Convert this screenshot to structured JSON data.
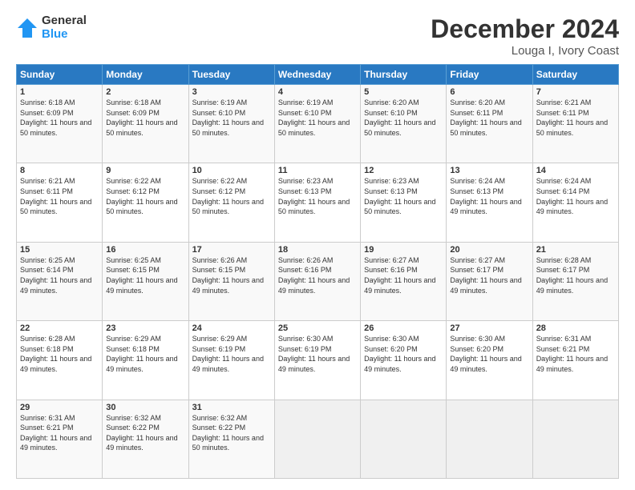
{
  "header": {
    "logo_general": "General",
    "logo_blue": "Blue",
    "month_title": "December 2024",
    "location": "Louga I, Ivory Coast"
  },
  "days_of_week": [
    "Sunday",
    "Monday",
    "Tuesday",
    "Wednesday",
    "Thursday",
    "Friday",
    "Saturday"
  ],
  "weeks": [
    [
      {
        "day": "1",
        "sunrise": "6:18 AM",
        "sunset": "6:09 PM",
        "daylight": "11 hours and 50 minutes."
      },
      {
        "day": "2",
        "sunrise": "6:18 AM",
        "sunset": "6:09 PM",
        "daylight": "11 hours and 50 minutes."
      },
      {
        "day": "3",
        "sunrise": "6:19 AM",
        "sunset": "6:10 PM",
        "daylight": "11 hours and 50 minutes."
      },
      {
        "day": "4",
        "sunrise": "6:19 AM",
        "sunset": "6:10 PM",
        "daylight": "11 hours and 50 minutes."
      },
      {
        "day": "5",
        "sunrise": "6:20 AM",
        "sunset": "6:10 PM",
        "daylight": "11 hours and 50 minutes."
      },
      {
        "day": "6",
        "sunrise": "6:20 AM",
        "sunset": "6:11 PM",
        "daylight": "11 hours and 50 minutes."
      },
      {
        "day": "7",
        "sunrise": "6:21 AM",
        "sunset": "6:11 PM",
        "daylight": "11 hours and 50 minutes."
      }
    ],
    [
      {
        "day": "8",
        "sunrise": "6:21 AM",
        "sunset": "6:11 PM",
        "daylight": "11 hours and 50 minutes."
      },
      {
        "day": "9",
        "sunrise": "6:22 AM",
        "sunset": "6:12 PM",
        "daylight": "11 hours and 50 minutes."
      },
      {
        "day": "10",
        "sunrise": "6:22 AM",
        "sunset": "6:12 PM",
        "daylight": "11 hours and 50 minutes."
      },
      {
        "day": "11",
        "sunrise": "6:23 AM",
        "sunset": "6:13 PM",
        "daylight": "11 hours and 50 minutes."
      },
      {
        "day": "12",
        "sunrise": "6:23 AM",
        "sunset": "6:13 PM",
        "daylight": "11 hours and 50 minutes."
      },
      {
        "day": "13",
        "sunrise": "6:24 AM",
        "sunset": "6:13 PM",
        "daylight": "11 hours and 49 minutes."
      },
      {
        "day": "14",
        "sunrise": "6:24 AM",
        "sunset": "6:14 PM",
        "daylight": "11 hours and 49 minutes."
      }
    ],
    [
      {
        "day": "15",
        "sunrise": "6:25 AM",
        "sunset": "6:14 PM",
        "daylight": "11 hours and 49 minutes."
      },
      {
        "day": "16",
        "sunrise": "6:25 AM",
        "sunset": "6:15 PM",
        "daylight": "11 hours and 49 minutes."
      },
      {
        "day": "17",
        "sunrise": "6:26 AM",
        "sunset": "6:15 PM",
        "daylight": "11 hours and 49 minutes."
      },
      {
        "day": "18",
        "sunrise": "6:26 AM",
        "sunset": "6:16 PM",
        "daylight": "11 hours and 49 minutes."
      },
      {
        "day": "19",
        "sunrise": "6:27 AM",
        "sunset": "6:16 PM",
        "daylight": "11 hours and 49 minutes."
      },
      {
        "day": "20",
        "sunrise": "6:27 AM",
        "sunset": "6:17 PM",
        "daylight": "11 hours and 49 minutes."
      },
      {
        "day": "21",
        "sunrise": "6:28 AM",
        "sunset": "6:17 PM",
        "daylight": "11 hours and 49 minutes."
      }
    ],
    [
      {
        "day": "22",
        "sunrise": "6:28 AM",
        "sunset": "6:18 PM",
        "daylight": "11 hours and 49 minutes."
      },
      {
        "day": "23",
        "sunrise": "6:29 AM",
        "sunset": "6:18 PM",
        "daylight": "11 hours and 49 minutes."
      },
      {
        "day": "24",
        "sunrise": "6:29 AM",
        "sunset": "6:19 PM",
        "daylight": "11 hours and 49 minutes."
      },
      {
        "day": "25",
        "sunrise": "6:30 AM",
        "sunset": "6:19 PM",
        "daylight": "11 hours and 49 minutes."
      },
      {
        "day": "26",
        "sunrise": "6:30 AM",
        "sunset": "6:20 PM",
        "daylight": "11 hours and 49 minutes."
      },
      {
        "day": "27",
        "sunrise": "6:30 AM",
        "sunset": "6:20 PM",
        "daylight": "11 hours and 49 minutes."
      },
      {
        "day": "28",
        "sunrise": "6:31 AM",
        "sunset": "6:21 PM",
        "daylight": "11 hours and 49 minutes."
      }
    ],
    [
      {
        "day": "29",
        "sunrise": "6:31 AM",
        "sunset": "6:21 PM",
        "daylight": "11 hours and 49 minutes."
      },
      {
        "day": "30",
        "sunrise": "6:32 AM",
        "sunset": "6:22 PM",
        "daylight": "11 hours and 49 minutes."
      },
      {
        "day": "31",
        "sunrise": "6:32 AM",
        "sunset": "6:22 PM",
        "daylight": "11 hours and 50 minutes."
      },
      null,
      null,
      null,
      null
    ]
  ]
}
